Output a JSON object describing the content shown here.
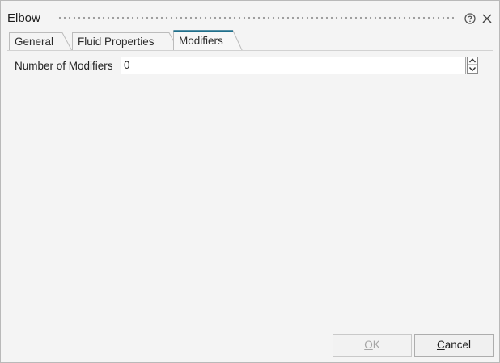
{
  "window": {
    "title": "Elbow",
    "help_icon": "help-circle-icon",
    "close_icon": "close-icon"
  },
  "tabs": [
    {
      "label": "General",
      "active": false
    },
    {
      "label": "Fluid Properties",
      "active": false
    },
    {
      "label": "Modifiers",
      "active": true
    }
  ],
  "modifiers": {
    "label": "Number of Modifiers",
    "value": "0"
  },
  "buttons": {
    "ok": {
      "mnemonic": "O",
      "rest": "K",
      "enabled": false
    },
    "cancel": {
      "mnemonic": "C",
      "rest": "ancel",
      "enabled": true
    }
  },
  "colors": {
    "active_tab_accent": "#1f6f8b",
    "background": "#f4f4f4"
  }
}
